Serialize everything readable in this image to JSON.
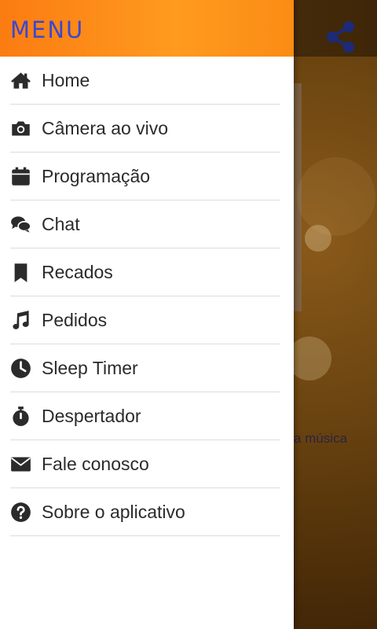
{
  "drawer": {
    "title": "MENU",
    "items": [
      {
        "label": "Home",
        "icon": "home-icon"
      },
      {
        "label": "Câmera ao vivo",
        "icon": "camera-icon"
      },
      {
        "label": "Programação",
        "icon": "calendar-icon"
      },
      {
        "label": "Chat",
        "icon": "chat-icon"
      },
      {
        "label": "Recados",
        "icon": "bookmark-icon"
      },
      {
        "label": "Pedidos",
        "icon": "music-note-icon"
      },
      {
        "label": "Sleep Timer",
        "icon": "clock-icon"
      },
      {
        "label": "Despertador",
        "icon": "stopwatch-icon"
      },
      {
        "label": "Fale conosco",
        "icon": "envelope-icon"
      },
      {
        "label": "Sobre o aplicativo",
        "icon": "question-circle-icon"
      }
    ]
  },
  "background": {
    "snippet_text": "a música",
    "share_icon": "share-icon"
  },
  "colors": {
    "header_orange": "#fb8c15",
    "title_blue": "#3a48d0",
    "icon_dark": "#2b2b2b",
    "share_blue": "#1c2a78"
  }
}
